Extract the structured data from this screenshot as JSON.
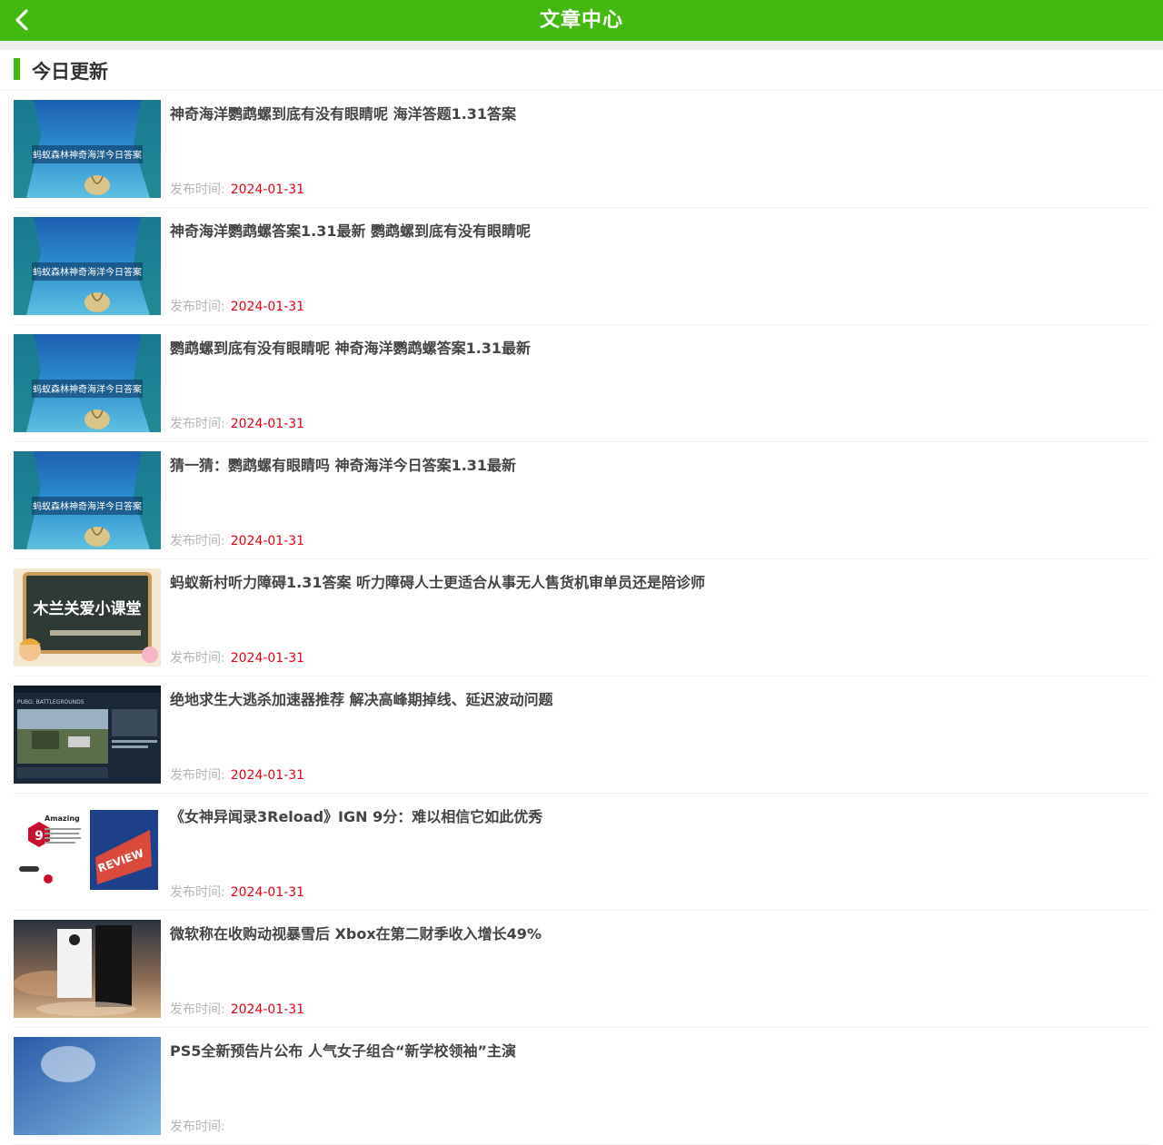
{
  "header": {
    "title": "文章中心",
    "back_icon": "chevron-left-icon",
    "bg_color": "#42b90f"
  },
  "section": {
    "title": "今日更新",
    "accent_color": "#42b90f"
  },
  "date_label": "发布时间:",
  "date_color": "#e60012",
  "articles": [
    {
      "title": "神奇海洋鹦鹉螺到底有没有眼睛呢 海洋答题1.31答案",
      "date": "2024-01-31",
      "thumb_text": "蚂蚁森林神奇海洋今日答案"
    },
    {
      "title": "神奇海洋鹦鹉螺答案1.31最新 鹦鹉螺到底有没有眼睛呢",
      "date": "2024-01-31",
      "thumb_text": "蚂蚁森林神奇海洋今日答案"
    },
    {
      "title": "鹦鹉螺到底有没有眼睛呢 神奇海洋鹦鹉螺答案1.31最新",
      "date": "2024-01-31",
      "thumb_text": "蚂蚁森林神奇海洋今日答案"
    },
    {
      "title": "猜一猜：鹦鹉螺有眼睛吗 神奇海洋今日答案1.31最新",
      "date": "2024-01-31",
      "thumb_text": "蚂蚁森林神奇海洋今日答案"
    },
    {
      "title": "蚂蚁新村听力障碍1.31答案 听力障碍人士更适合从事无人售货机审单员还是陪诊师",
      "date": "2024-01-31",
      "thumb_text": "木兰关爱小课堂"
    },
    {
      "title": "绝地求生大逃杀加速器推荐 解决高峰期掉线、延迟波动问题",
      "date": "2024-01-31",
      "thumb_text": "PUBG: BATTLEGROUNDS"
    },
    {
      "title": "《女神异闻录3Reload》IGN 9分：难以相信它如此优秀",
      "date": "2024-01-31",
      "thumb_text": "Amazing"
    },
    {
      "title": "微软称在收购动视暴雪后 Xbox在第二财季收入增长49%",
      "date": "2024-01-31",
      "thumb_text": ""
    },
    {
      "title": "PS5全新预告片公布 人气女子组合“新学校领袖”主演",
      "date": "",
      "thumb_text": ""
    }
  ]
}
